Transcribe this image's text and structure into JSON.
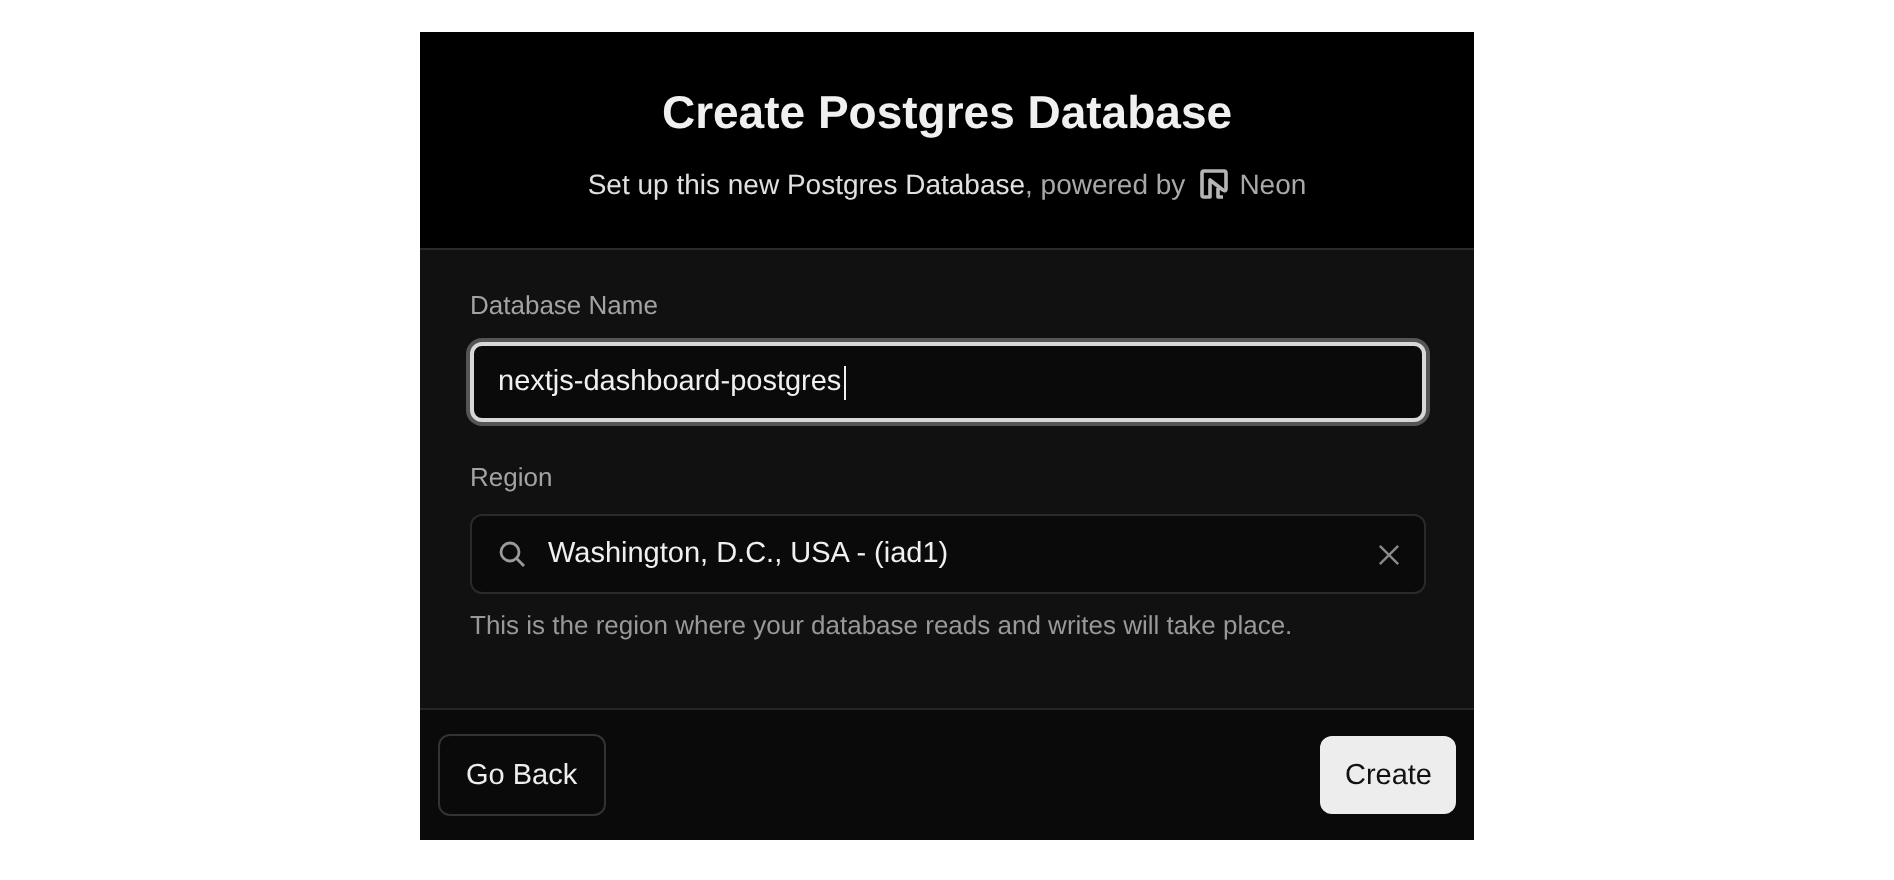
{
  "dialog": {
    "title": "Create Postgres Database",
    "subtitle": "Set up this new Postgres Database",
    "powered_by": ", powered by",
    "brand": "Neon"
  },
  "fields": [
    {
      "kind": "text",
      "label": "Database Name",
      "value": "nextjs-dashboard-postgres",
      "focused": true
    },
    {
      "kind": "search",
      "label": "Region",
      "value": "Washington, D.C., USA - (iad1)",
      "focused": false,
      "hint": "This is the region where your database reads and writes will take place."
    }
  ],
  "buttons": [
    {
      "label": "Go Back",
      "kind": "secondary"
    },
    {
      "label": "Create",
      "kind": "primary"
    }
  ]
}
